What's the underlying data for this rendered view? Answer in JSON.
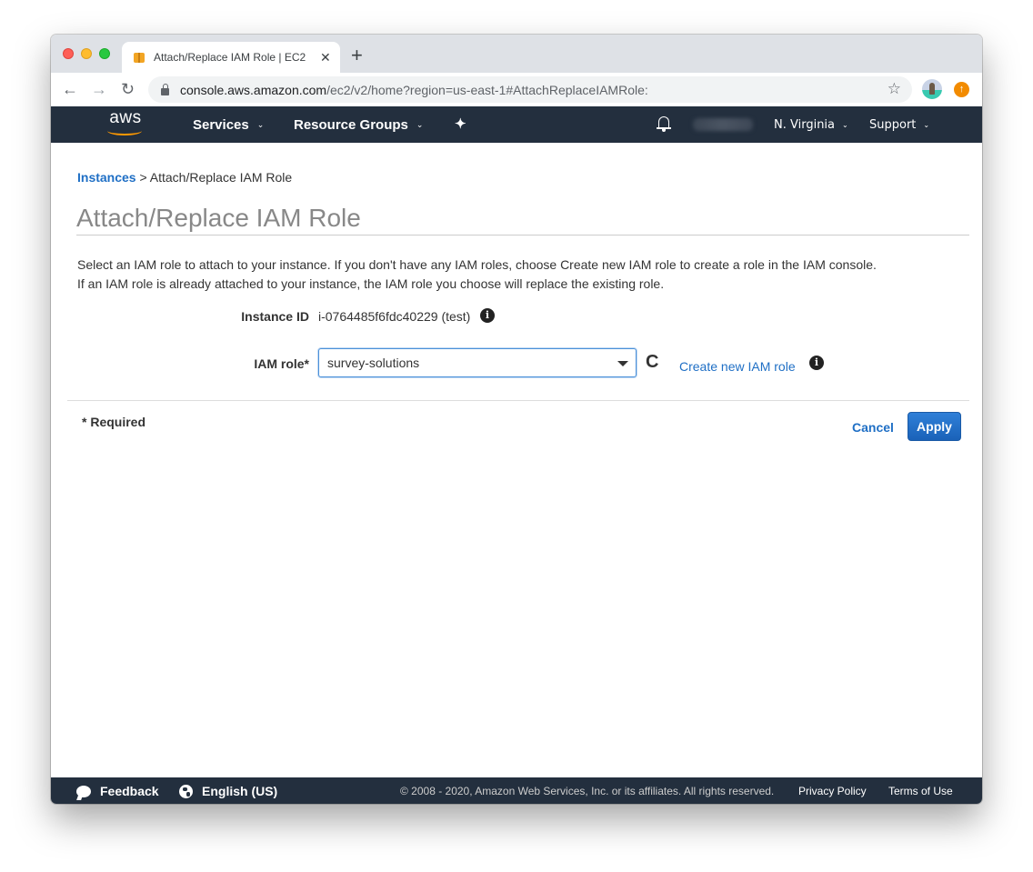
{
  "browser": {
    "tab_title": "Attach/Replace IAM Role | EC2",
    "tab_close": "✕",
    "new_tab": "+",
    "url_host": "console.aws.amazon.com",
    "url_path": "/ec2/v2/home?region=us-east-1#AttachReplaceIAMRole:",
    "back": "←",
    "forward": "→",
    "reload": "↻",
    "bookmark": "☆",
    "update": "↑"
  },
  "aws_nav": {
    "logo": "aws",
    "services": "Services",
    "resource_groups": "Resource Groups",
    "pin": "✦",
    "chevron": "⌄",
    "region": "N. Virginia",
    "support": "Support"
  },
  "breadcrumb": {
    "link": "Instances",
    "separator": " > ",
    "current": "Attach/Replace IAM Role"
  },
  "page": {
    "title": "Attach/Replace IAM Role",
    "desc_line1": "Select an IAM role to attach to your instance. If you don't have any IAM roles, choose Create new IAM role to create a role in the IAM console.",
    "desc_line2": "If an IAM role is already attached to your instance, the IAM role you choose will replace the existing role."
  },
  "form": {
    "instance_label": "Instance ID",
    "instance_value": "i-0764485f6fdc40229 (test)",
    "role_label": "IAM role*",
    "role_value": "survey-solutions",
    "refresh": "C",
    "create_link": "Create new IAM role",
    "info": "i",
    "required_note": "* Required",
    "cancel": "Cancel",
    "apply": "Apply"
  },
  "footer": {
    "feedback": "Feedback",
    "language": "English (US)",
    "copyright": "© 2008 - 2020, Amazon Web Services, Inc. or its affiliates. All rights reserved.",
    "privacy": "Privacy Policy",
    "terms": "Terms of Use"
  },
  "colors": {
    "aws_navy": "#232f3e",
    "aws_orange": "#ff9900",
    "link_blue": "#1f6fc5",
    "primary_button": "#1a62b8"
  }
}
